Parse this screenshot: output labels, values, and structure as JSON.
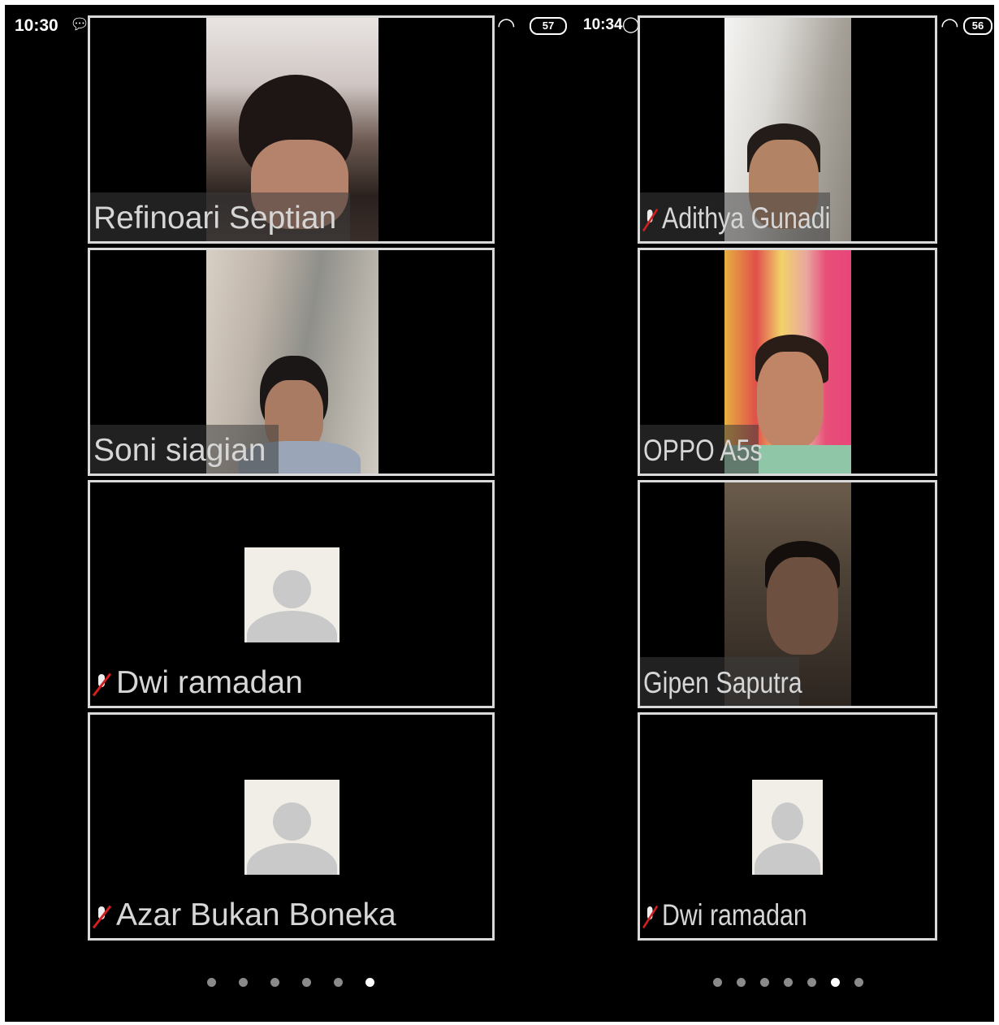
{
  "left": {
    "status": {
      "time": "10:30",
      "battery": "57"
    },
    "tiles": [
      {
        "name": "Refinoari Septian",
        "muted": false,
        "video": true
      },
      {
        "name": "Soni siagian",
        "muted": false,
        "video": true
      },
      {
        "name": "Dwi ramadan",
        "muted": true,
        "video": false
      },
      {
        "name": "Azar Bukan Boneka",
        "muted": true,
        "video": false
      }
    ],
    "page_indicator": {
      "count": 6,
      "active_index": 5
    }
  },
  "right": {
    "status": {
      "time": "10:34",
      "battery": "56"
    },
    "tiles": [
      {
        "name": "Adithya Gunadi",
        "muted": true,
        "video": true
      },
      {
        "name": "OPPO A5s",
        "muted": false,
        "video": true
      },
      {
        "name": "Gipen Saputra",
        "muted": false,
        "video": true
      },
      {
        "name": "Dwi ramadan",
        "muted": true,
        "video": false
      }
    ],
    "page_indicator": {
      "count": 7,
      "active_index": 5
    }
  },
  "colors": {
    "background": "#000000",
    "tile_border": "#d9d9d9",
    "muted_mic": "#d02020",
    "avatar_bg": "#f1eee8"
  },
  "icons": [
    "chat-bubble-icon",
    "shopping-bag-icon",
    "video-camera-icon",
    "signal-icon",
    "wifi-icon",
    "battery-icon",
    "whatsapp-icon",
    "mic-muted-icon",
    "default-avatar-icon"
  ]
}
